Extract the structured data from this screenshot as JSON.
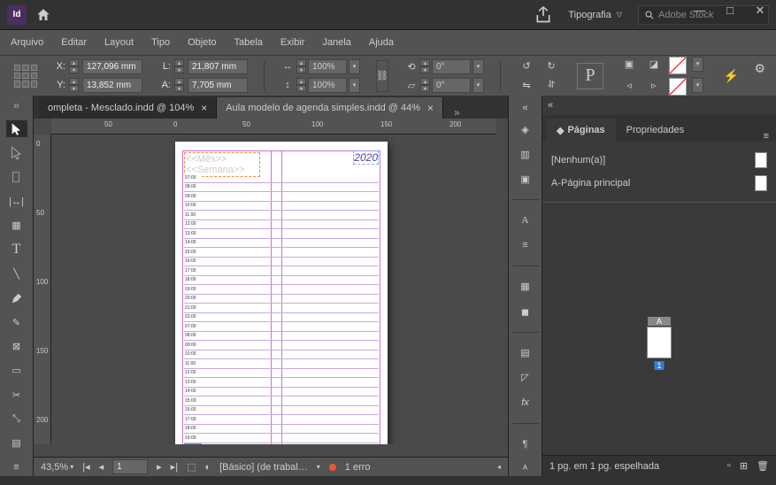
{
  "titlebar": {
    "workspace": "Tipografia",
    "search_placeholder": "Adobe Stock"
  },
  "menu": {
    "items": [
      "Arquivo",
      "Editar",
      "Layout",
      "Tipo",
      "Objeto",
      "Tabela",
      "Exibir",
      "Janela",
      "Ajuda"
    ]
  },
  "control": {
    "x_label": "X:",
    "y_label": "Y:",
    "l_label": "L:",
    "a_label": "A:",
    "x": "127,096 mm",
    "y": "13,852 mm",
    "l": "21,807 mm",
    "a": "7,705 mm",
    "sx": "100%",
    "sy": "100%",
    "rot": "0°",
    "shear": "0°",
    "char": "P"
  },
  "tabs": {
    "t1": "ompleta - Mesclado.indd @ 104%",
    "t2": "Aula modelo de agenda simples.indd @ 44%"
  },
  "ruler_h": [
    "50",
    "0",
    "50",
    "100",
    "150",
    "200"
  ],
  "ruler_v": [
    "0",
    "50",
    "100",
    "150",
    "200"
  ],
  "page": {
    "header1": "<<Mês>>",
    "header2": "<<Semana>>",
    "year": "2020",
    "times": [
      "07:00",
      "08:00",
      "09:00",
      "10:00",
      "11:00",
      "12:00",
      "13:00",
      "14:00",
      "15:00",
      "16:00",
      "17:00",
      "18:00",
      "19:00",
      "20:00",
      "21:00",
      "22:00",
      "07:00",
      "08:00",
      "09:00",
      "10:00",
      "11:00",
      "12:00",
      "13:00",
      "14:00",
      "15:00",
      "16:00",
      "17:00",
      "18:00",
      "19:00"
    ]
  },
  "status": {
    "zoom": "43,5%",
    "page": "1",
    "style": "[Básico] (de trabal…",
    "errors": "1 erro"
  },
  "rpanel": {
    "tab1": "Páginas",
    "tab2": "Propriedades",
    "master_none": "[Nenhum(a)]",
    "master_a": "A-Página principal",
    "thumb_a": "A",
    "thumb_num": "1",
    "status": "1 pg. em 1 pg. espelhada"
  }
}
